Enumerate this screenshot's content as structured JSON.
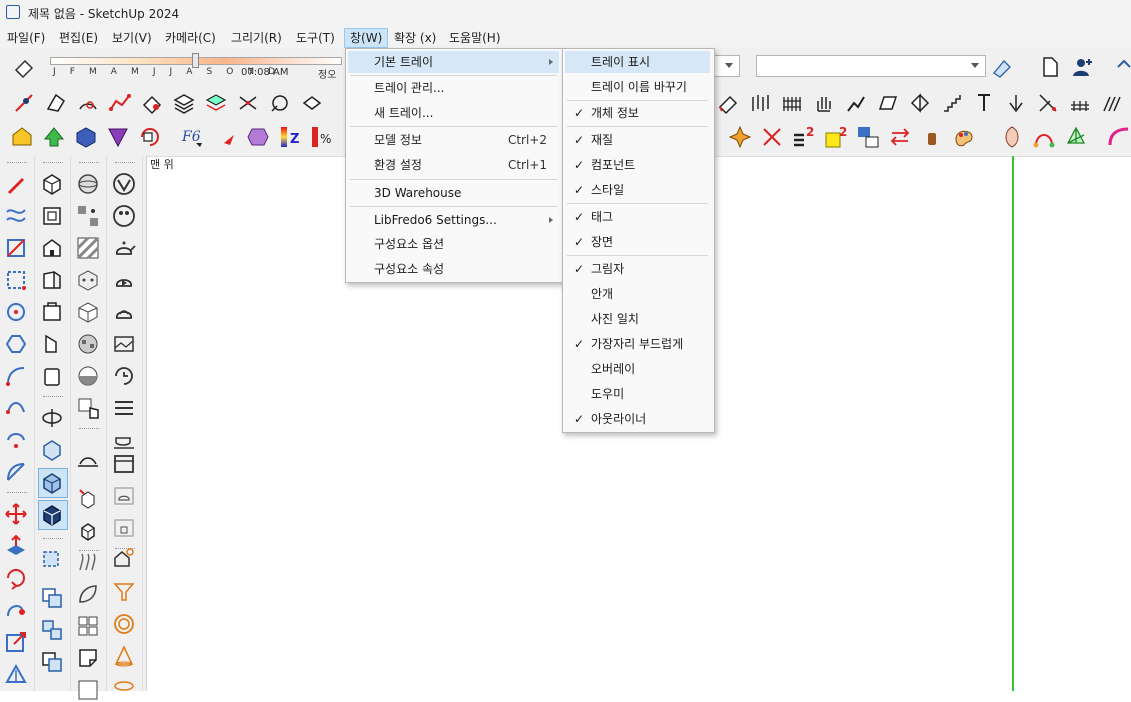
{
  "window": {
    "title": "제목 없음 - SketchUp 2024"
  },
  "menubar": {
    "items": [
      {
        "label": "파일(F)"
      },
      {
        "label": "편집(E)"
      },
      {
        "label": "보기(V)"
      },
      {
        "label": "카메라(C)"
      },
      {
        "label": "그리기(R)"
      },
      {
        "label": "도구(T)"
      },
      {
        "label": "창(W)"
      },
      {
        "label": "확장 (x)"
      },
      {
        "label": "도움말(H)"
      }
    ]
  },
  "shadow": {
    "months": "J F M A M J J A S O N D",
    "time": "07:08 AM",
    "noon": "정오"
  },
  "canvas": {
    "label": "맨 위"
  },
  "window_menu": {
    "items": [
      {
        "label": "기본 트레이",
        "submenu": true
      },
      {
        "label": "트레이 관리..."
      },
      {
        "label": "새 트레이..."
      },
      {
        "label": "모델 정보",
        "shortcut": "Ctrl+2"
      },
      {
        "label": "환경 설정",
        "shortcut": "Ctrl+1"
      },
      {
        "label": "3D Warehouse"
      },
      {
        "label": "LibFredo6 Settings...",
        "submenu": true
      },
      {
        "label": "구성요소 옵션"
      },
      {
        "label": "구성요소 속성"
      }
    ]
  },
  "tray_submenu": {
    "items": [
      {
        "label": "트레이 표시",
        "checked": false
      },
      {
        "label": "트레이 이름 바꾸기",
        "checked": false
      },
      {
        "label": "개체 정보",
        "checked": true
      },
      {
        "label": "재질",
        "checked": true
      },
      {
        "label": "컴포넌트",
        "checked": true
      },
      {
        "label": "스타일",
        "checked": true
      },
      {
        "label": "태그",
        "checked": true
      },
      {
        "label": "장면",
        "checked": true
      },
      {
        "label": "그림자",
        "checked": true
      },
      {
        "label": "안개",
        "checked": false
      },
      {
        "label": "사진 일치",
        "checked": false
      },
      {
        "label": "가장자리 부드럽게",
        "checked": true
      },
      {
        "label": "오버레이",
        "checked": false
      },
      {
        "label": "도우미",
        "checked": false
      },
      {
        "label": "아웃라이너",
        "checked": true
      }
    ]
  },
  "colors": {
    "highlight": "#d6e8f7",
    "axis_green": "#3ac23a",
    "menu_active": "#cde4f7"
  },
  "icons": {
    "check": "✓"
  }
}
